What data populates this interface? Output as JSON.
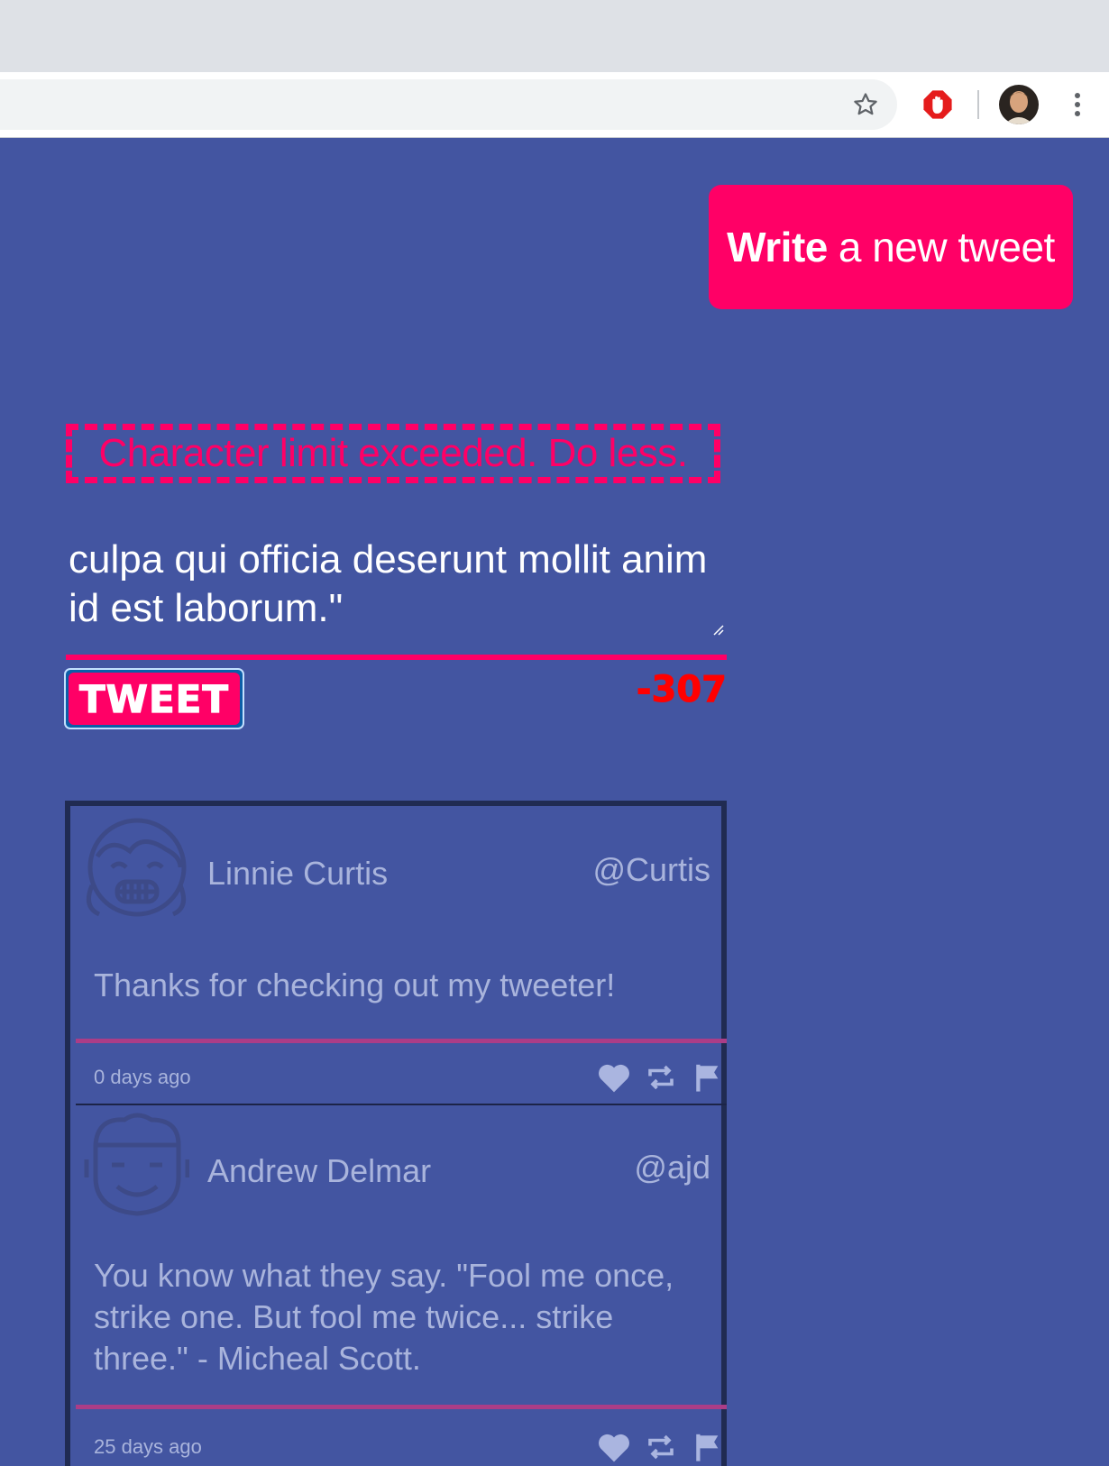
{
  "browser": {
    "icons": [
      "star-icon",
      "adblock-icon",
      "profile-avatar",
      "menu-kebab-icon"
    ]
  },
  "header": {
    "write_button": {
      "strong": "Write",
      "rest": "a new tweet"
    }
  },
  "compose": {
    "error": "Character limit exceeded. Do less.",
    "text": "culpa qui officia deserunt mollit anim id est laborum.\"",
    "tweet_button": "TWEET",
    "counter": "-307"
  },
  "feed": {
    "tweets": [
      {
        "name": "Linnie Curtis",
        "handle": "@Curtis",
        "body": "Thanks for checking out my tweeter!",
        "time": "0 days ago",
        "actions": [
          "heart-icon",
          "retweet-icon",
          "flag-icon"
        ]
      },
      {
        "name": "Andrew Delmar",
        "handle": "@ajd",
        "body": "You know what they say. \"Fool me once, strike one. But fool me twice... strike three.\" - Micheal Scott.",
        "time": "25 days ago",
        "actions": [
          "heart-icon",
          "retweet-icon",
          "flag-icon"
        ]
      }
    ]
  },
  "colors": {
    "background": "#4355a1",
    "accent": "#ff0066",
    "counter": "#ff0000",
    "muted_text": "#a9b4dc",
    "tweet_divider": "#ab3d87"
  }
}
